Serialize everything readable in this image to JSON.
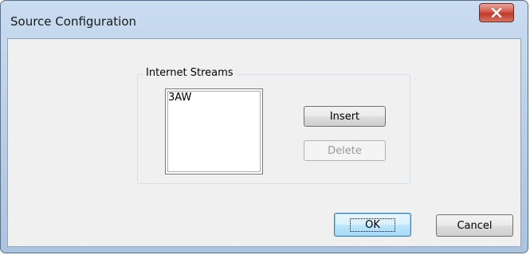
{
  "window": {
    "title": "Source Configuration"
  },
  "group": {
    "label": "Internet Streams",
    "streams": [
      "3AW"
    ]
  },
  "buttons": {
    "insert": "Insert",
    "delete": "Delete",
    "ok": "OK",
    "cancel": "Cancel"
  },
  "icons": {
    "close": "close-icon"
  },
  "colors": {
    "close_button": "#c0392b",
    "default_button_border": "#3c7fb1"
  }
}
